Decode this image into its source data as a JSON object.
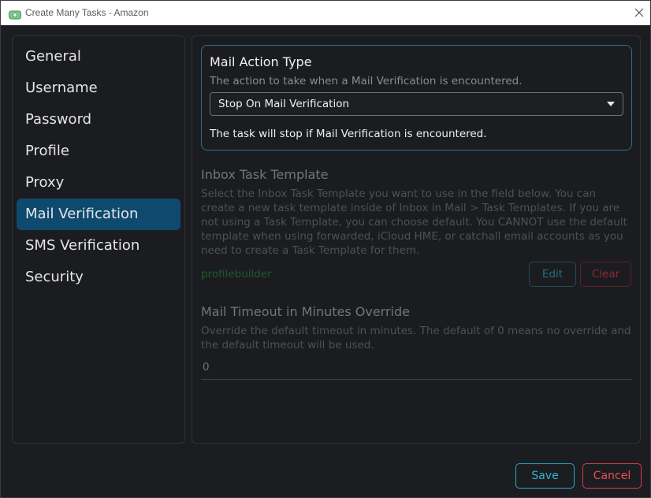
{
  "window": {
    "title": "Create Many Tasks - Amazon",
    "app_icon": "cash-icon",
    "close_icon": "close-icon"
  },
  "sidebar": {
    "items": [
      {
        "label": "General",
        "active": false
      },
      {
        "label": "Username",
        "active": false
      },
      {
        "label": "Password",
        "active": false
      },
      {
        "label": "Profile",
        "active": false
      },
      {
        "label": "Proxy",
        "active": false
      },
      {
        "label": "Mail Verification",
        "active": true
      },
      {
        "label": "SMS Verification",
        "active": false
      },
      {
        "label": "Security",
        "active": false
      }
    ]
  },
  "mail_action": {
    "title": "Mail Action Type",
    "description": "The action to take when a Mail Verification is encountered.",
    "selected": "Stop On Mail Verification",
    "note": "The task will stop if Mail Verification is encountered."
  },
  "inbox_template": {
    "title": "Inbox Task Template",
    "description": "Select the Inbox Task Template you want to use in the field below. You can create a new task template inside of Inbox in Mail > Task Templates. If you are not using a Task Template, you can choose default. You CANNOT use the default template when using forwarded, iCloud HME, or catchall email accounts as you need to create a Task Template for them.",
    "value": "profilebuilder",
    "edit_label": "Edit",
    "clear_label": "Clear"
  },
  "mail_timeout": {
    "title": "Mail Timeout in Minutes Override",
    "description": "Override the default timeout in minutes. The default of 0 means no override and the default timeout will be used.",
    "value": "0"
  },
  "footer": {
    "save_label": "Save",
    "cancel_label": "Cancel"
  },
  "colors": {
    "accent": "#0e4a6e",
    "save": "#2eb6dc",
    "cancel": "#ef4a58",
    "card_border": "#2b6f8e"
  }
}
